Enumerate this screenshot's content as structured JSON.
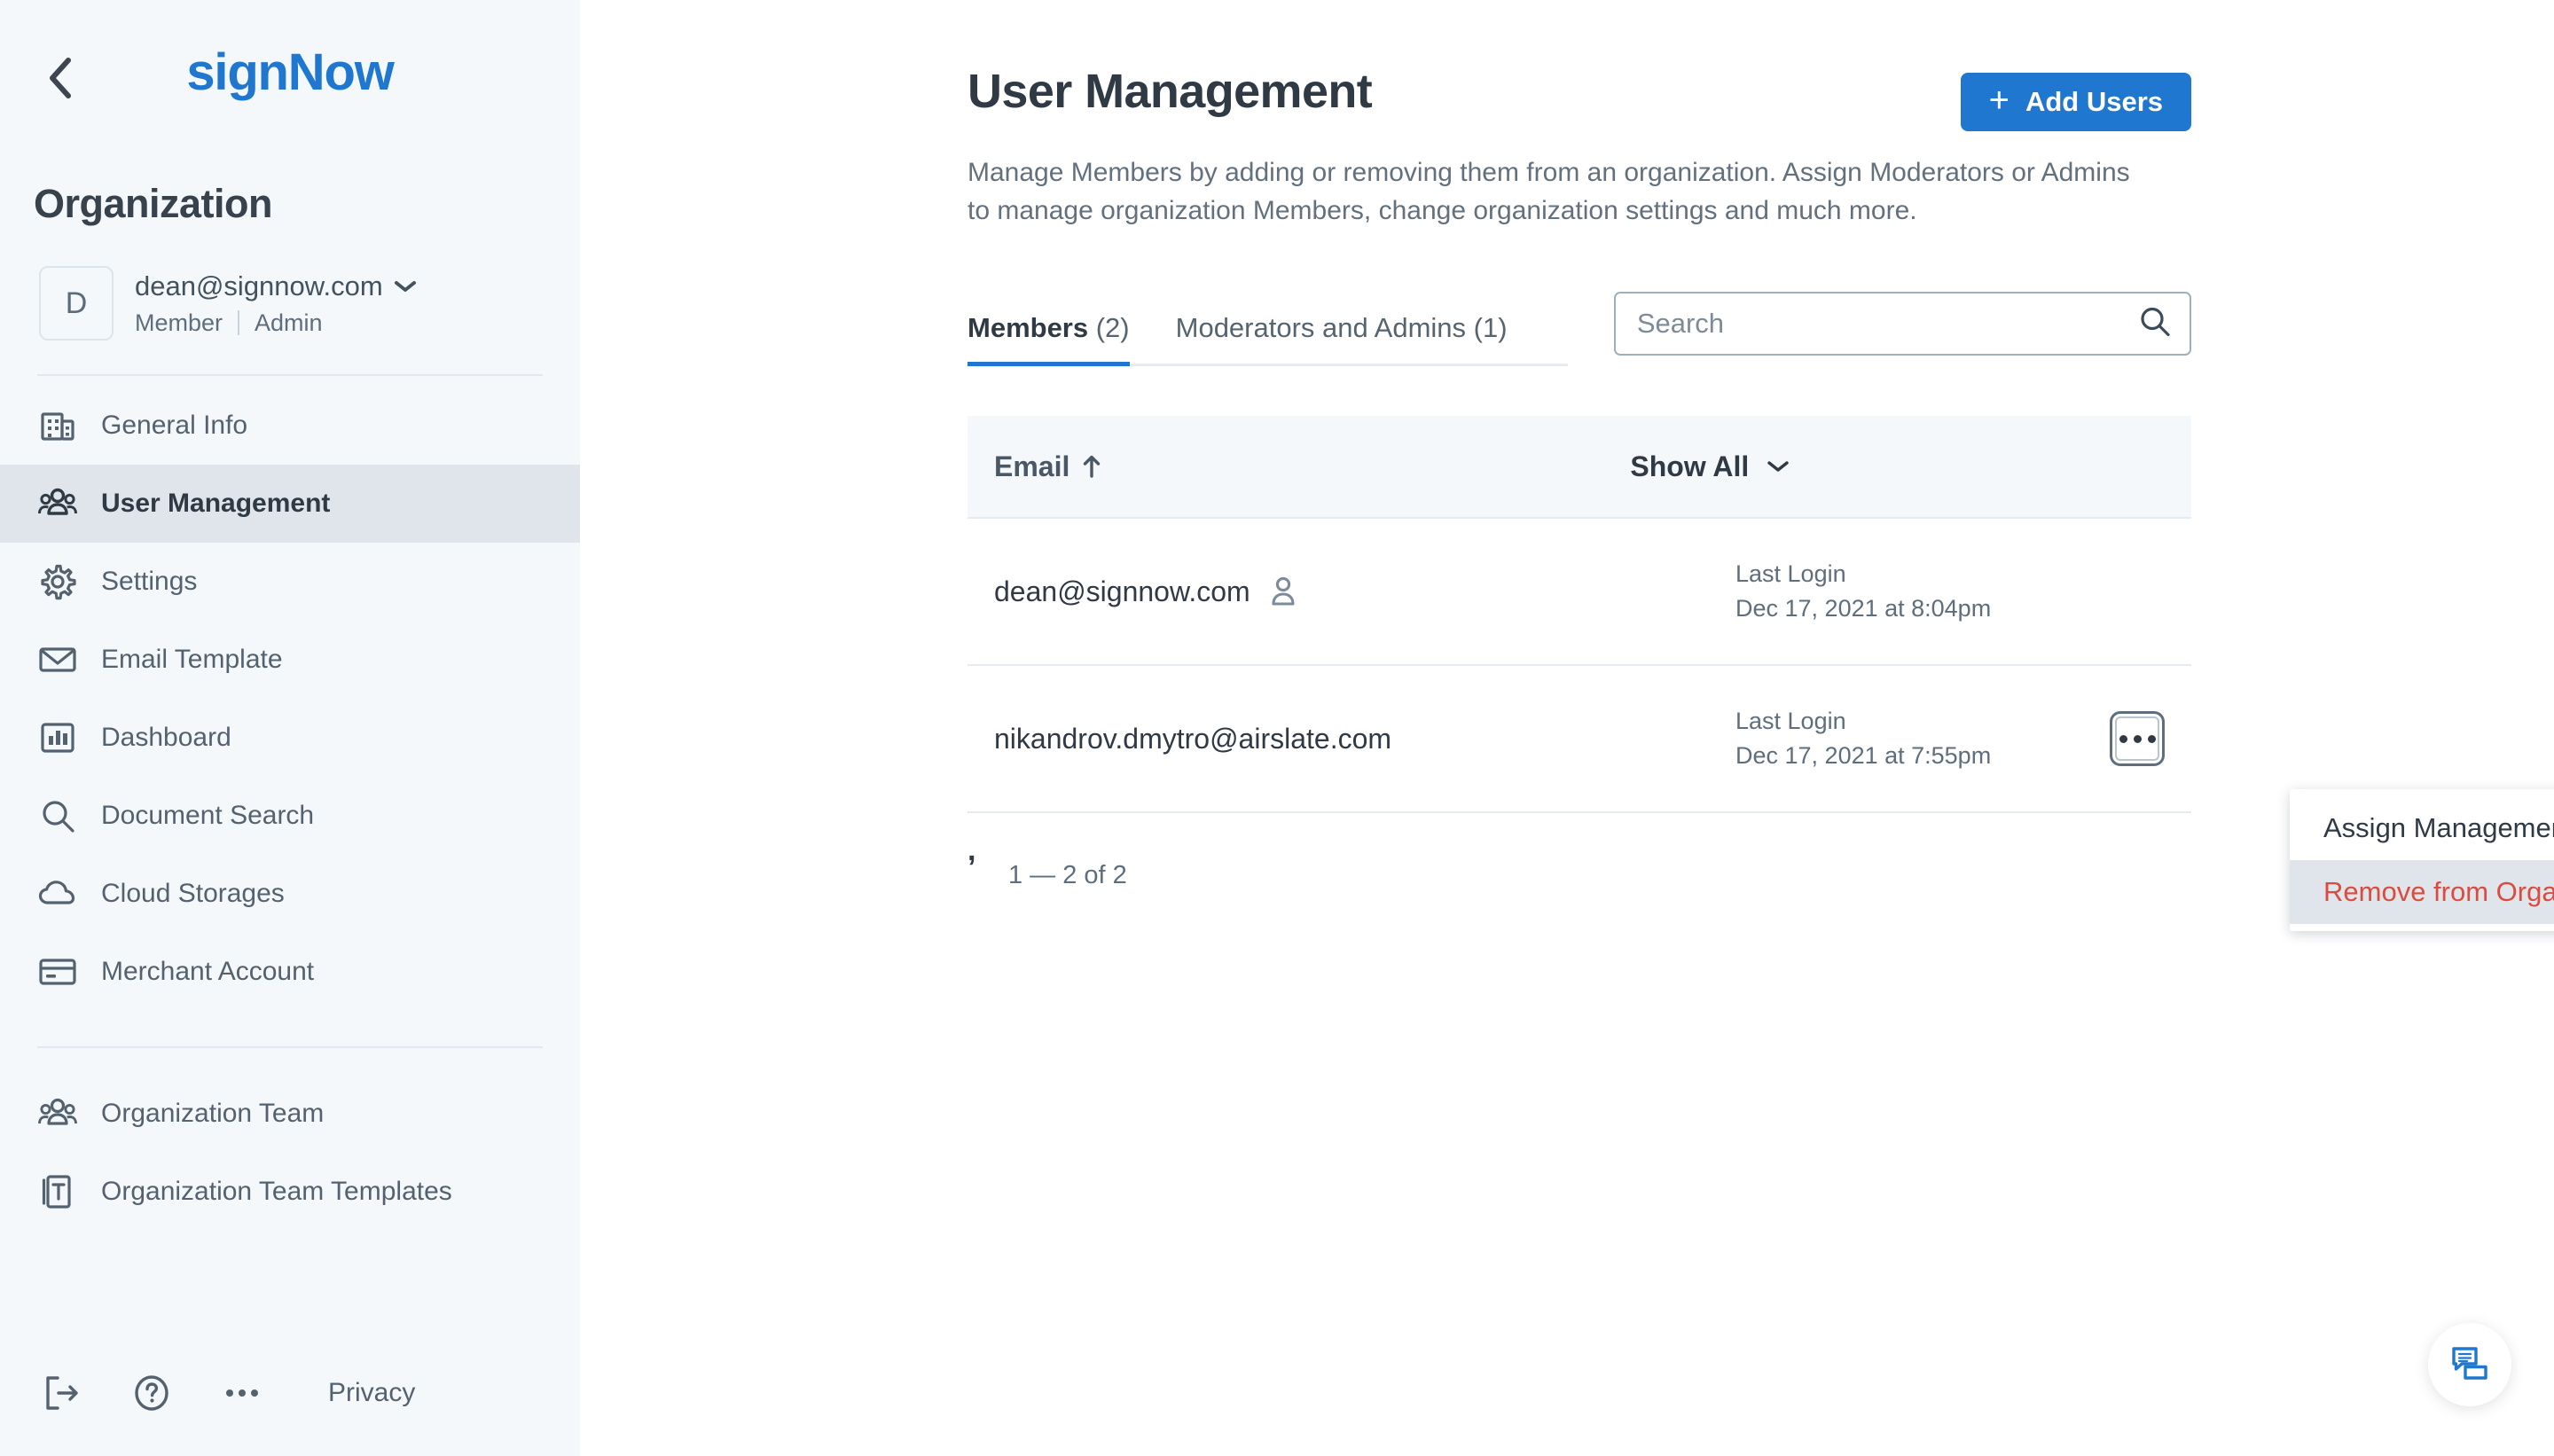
{
  "sidebar": {
    "back_icon": "chevron-left-icon",
    "brand": "signNow",
    "org_title": "Organization",
    "account": {
      "avatar_initial": "D",
      "email": "dean@signnow.com",
      "role_primary": "Member",
      "role_secondary": "Admin"
    },
    "nav": [
      {
        "label": "General Info",
        "icon": "building-icon",
        "active": false
      },
      {
        "label": "User Management",
        "icon": "users-icon",
        "active": true
      },
      {
        "label": "Settings",
        "icon": "gear-icon",
        "active": false
      },
      {
        "label": "Email Template",
        "icon": "envelope-icon",
        "active": false
      },
      {
        "label": "Dashboard",
        "icon": "chart-bar-icon",
        "active": false
      },
      {
        "label": "Document Search",
        "icon": "search-icon",
        "active": false
      },
      {
        "label": "Cloud Storages",
        "icon": "cloud-icon",
        "active": false
      },
      {
        "label": "Merchant Account",
        "icon": "credit-card-icon",
        "active": false
      }
    ],
    "nav_secondary": [
      {
        "label": "Organization Team",
        "icon": "users-icon",
        "active": false
      },
      {
        "label": "Organization Team Templates",
        "icon": "template-t-icon",
        "active": false
      }
    ],
    "footer": {
      "logout_icon": "logout-icon",
      "help_icon": "question-circle-icon",
      "more_icon": "ellipsis-icon",
      "privacy_label": "Privacy"
    }
  },
  "main": {
    "title": "User Management",
    "add_users_label": "Add Users",
    "add_users_plus": "+",
    "description": "Manage Members by adding or removing them from an organization. Assign Moderators or Admins to manage organization Members, change organization settings and much more.",
    "tabs": [
      {
        "label": "Members",
        "count": "(2)",
        "active": true
      },
      {
        "label": "Moderators and Admins",
        "count": "(1)",
        "active": false
      }
    ],
    "search": {
      "placeholder": "Search",
      "value": "",
      "icon": "search-icon"
    },
    "table": {
      "header": {
        "email_label": "Email",
        "sort_arrow": "↑",
        "filter_label": "Show All",
        "filter_caret": "chevron-down-icon"
      },
      "rows": [
        {
          "email": "dean@signnow.com",
          "has_user_icon": true,
          "last_login_label": "Last Login",
          "last_login_value": "Dec 17, 2021 at 8:04pm",
          "has_kebab": false
        },
        {
          "email": "nikandrov.dmytro@airslate.com",
          "has_user_icon": false,
          "last_login_label": "Last Login",
          "last_login_value": "Dec 17, 2021 at 7:55pm",
          "has_kebab": true
        }
      ],
      "pagination": "1 — 2 of 2",
      "stray_mark": ","
    },
    "row_menu": {
      "items": [
        {
          "label": "Assign Management Rights",
          "danger": false,
          "hovered": false
        },
        {
          "label": "Remove from Organization",
          "danger": true,
          "hovered": true
        }
      ]
    },
    "chat_fab_icon": "chat-bubbles-icon"
  },
  "colors": {
    "brand_blue": "#2077cf",
    "sidebar_bg": "#f4f8fa",
    "active_nav_bg": "#dfe5eb",
    "danger_red": "#dd4b3e",
    "text_dark": "#2f3a45",
    "text_muted": "#5e6e7d"
  }
}
